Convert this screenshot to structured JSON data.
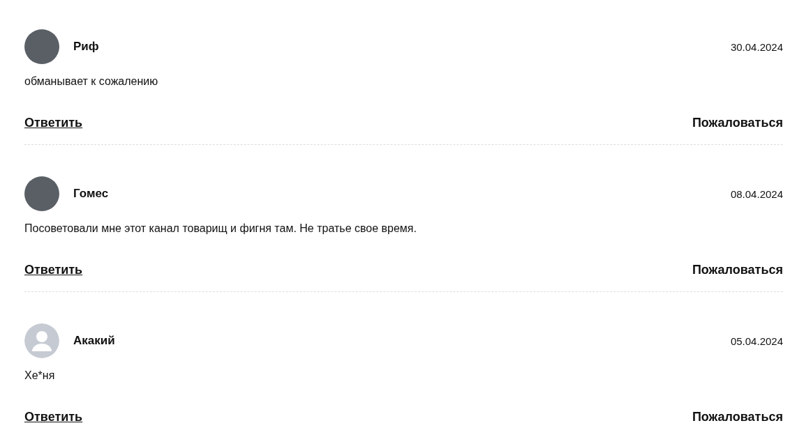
{
  "comments": [
    {
      "author": "Риф",
      "date": "30.04.2024",
      "text": "обманывает к сожалению",
      "avatar": {
        "kind": "photo"
      },
      "reply": "Ответить",
      "report": "Пожаловаться"
    },
    {
      "author": "Гомес",
      "date": "08.04.2024",
      "text": "Посоветовали мне этот канал товарищ и фигня там. Не тратье свое время.",
      "avatar": {
        "kind": "photo"
      },
      "reply": "Ответить",
      "report": "Пожаловаться"
    },
    {
      "author": "Акакий",
      "date": "05.04.2024",
      "text": "Хе*ня",
      "avatar": {
        "kind": "default"
      },
      "reply": "Ответить",
      "report": "Пожаловаться"
    }
  ]
}
